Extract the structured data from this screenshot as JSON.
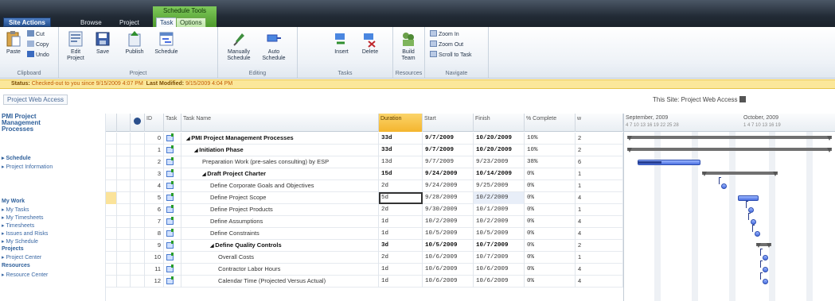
{
  "nav": {
    "site_actions": "Site Actions",
    "browse": "Browse",
    "project": "Project",
    "context_group": "Schedule Tools",
    "tab_task": "Task",
    "tab_options": "Options"
  },
  "ribbon": {
    "clipboard": {
      "label": "Clipboard",
      "paste": "Paste",
      "cut": "Cut",
      "copy": "Copy",
      "undo": "Undo"
    },
    "project": {
      "label": "Project",
      "edit": "Edit Project",
      "save": "Save",
      "publish": "Publish",
      "schedule": "Schedule"
    },
    "editing": {
      "label": "Editing",
      "manually": "Manually Schedule",
      "auto": "Auto Schedule"
    },
    "tasks": {
      "label": "Tasks",
      "insert": "Insert",
      "delete": "Delete"
    },
    "resources": {
      "label": "Resources",
      "build_team": "Build Team"
    },
    "navigate": {
      "label": "Navigate",
      "zoom_in": "Zoom In",
      "zoom_out": "Zoom Out",
      "scroll": "Scroll to Task"
    }
  },
  "status": {
    "label": "Status:",
    "text": "Checked-out to you since 9/15/2009 4:07 PM",
    "modified_label": "Last Modified:",
    "modified": "9/15/2009 4:04 PM"
  },
  "strip": {
    "breadcrumb": "Project Web Access",
    "site_title": "This Site: Project Web Access"
  },
  "leftnav": {
    "title": "PMI Project Management Processes",
    "schedule": "Schedule",
    "project_information": "Project Information",
    "my_work": "My Work",
    "my_work_items": [
      "My Tasks",
      "My Timesheets",
      "Timesheets",
      "Issues and Risks",
      "My Schedule"
    ],
    "projects": "Projects",
    "project_center": "Project Center",
    "resources": "Resources",
    "resource_center": "Resource Center"
  },
  "grid": {
    "columns": {
      "id": "ID",
      "mode": "Task",
      "name": "Task Name",
      "duration": "Duration",
      "start": "Start",
      "finish": "Finish",
      "pct": "% Complete",
      "extra": "w"
    },
    "rows": [
      {
        "id": "0",
        "name": "PMI Project Management Processes",
        "indent": 0,
        "summary": true,
        "duration": "33d",
        "start": "9/7/2009",
        "finish": "10/20/2009",
        "pct": "10%",
        "extra": "2"
      },
      {
        "id": "1",
        "name": "Initiation Phase",
        "indent": 1,
        "summary": true,
        "duration": "33d",
        "start": "9/7/2009",
        "finish": "10/20/2009",
        "pct": "10%",
        "extra": "2"
      },
      {
        "id": "2",
        "name": "Preparation Work (pre-sales consulting) by ESP",
        "indent": 2,
        "summary": false,
        "duration": "13d",
        "start": "9/7/2009",
        "finish": "9/23/2009",
        "pct": "38%",
        "extra": "6"
      },
      {
        "id": "3",
        "name": "Draft Project Charter",
        "indent": 2,
        "summary": true,
        "duration": "15d",
        "start": "9/24/2009",
        "finish": "10/14/2009",
        "pct": "0%",
        "extra": "1"
      },
      {
        "id": "4",
        "name": "Define Corporate Goals and Objectives",
        "indent": 3,
        "summary": false,
        "duration": "2d",
        "start": "9/24/2009",
        "finish": "9/25/2009",
        "pct": "0%",
        "extra": "1"
      },
      {
        "id": "5",
        "name": "Define Project Scope",
        "indent": 3,
        "summary": false,
        "duration": "5d",
        "start": "9/28/2009",
        "finish": "10/2/2009",
        "pct": "0%",
        "extra": "4"
      },
      {
        "id": "6",
        "name": "Define Project Products",
        "indent": 3,
        "summary": false,
        "duration": "2d",
        "start": "9/30/2009",
        "finish": "10/1/2009",
        "pct": "0%",
        "extra": "1"
      },
      {
        "id": "7",
        "name": "Define Assumptions",
        "indent": 3,
        "summary": false,
        "duration": "1d",
        "start": "10/2/2009",
        "finish": "10/2/2009",
        "pct": "0%",
        "extra": "4"
      },
      {
        "id": "8",
        "name": "Define Constraints",
        "indent": 3,
        "summary": false,
        "duration": "1d",
        "start": "10/5/2009",
        "finish": "10/5/2009",
        "pct": "0%",
        "extra": "4"
      },
      {
        "id": "9",
        "name": "Define Quality Controls",
        "indent": 3,
        "summary": true,
        "duration": "3d",
        "start": "10/5/2009",
        "finish": "10/7/2009",
        "pct": "0%",
        "extra": "2"
      },
      {
        "id": "10",
        "name": "Overall Costs",
        "indent": 4,
        "summary": false,
        "duration": "2d",
        "start": "10/6/2009",
        "finish": "10/7/2009",
        "pct": "0%",
        "extra": "1"
      },
      {
        "id": "11",
        "name": "Contractor Labor Hours",
        "indent": 4,
        "summary": false,
        "duration": "1d",
        "start": "10/6/2009",
        "finish": "10/6/2009",
        "pct": "0%",
        "extra": "4"
      },
      {
        "id": "12",
        "name": "Calendar Time (Projected Versus Actual)",
        "indent": 4,
        "summary": false,
        "duration": "1d",
        "start": "10/6/2009",
        "finish": "10/6/2009",
        "pct": "0%",
        "extra": "4"
      }
    ]
  },
  "gantt": {
    "month_left": "September, 2009",
    "month_right": "October, 2009",
    "days_left": "4  7  10 13 16 19 22 25 28",
    "days_right": "1  4  7  10 13 16 19",
    "bars": [
      {
        "type": "summary",
        "start": 0.0,
        "end": 0.98
      },
      {
        "type": "summary",
        "start": 0.0,
        "end": 0.98
      },
      {
        "type": "task",
        "start": 0.05,
        "end": 0.35,
        "progress": 0.38
      },
      {
        "type": "summary",
        "start": 0.36,
        "end": 0.72
      },
      {
        "type": "milestone",
        "start": 0.45
      },
      {
        "type": "task",
        "start": 0.53,
        "end": 0.63
      },
      {
        "type": "milestone",
        "start": 0.58
      },
      {
        "type": "milestone",
        "start": 0.59
      },
      {
        "type": "milestone",
        "start": 0.61
      },
      {
        "type": "summary",
        "start": 0.62,
        "end": 0.69
      },
      {
        "type": "milestone",
        "start": 0.65
      },
      {
        "type": "milestone",
        "start": 0.65
      },
      {
        "type": "milestone",
        "start": 0.65
      }
    ]
  },
  "colors": {
    "duration_header": "#f4b52e",
    "status_bar": "#fbe79a",
    "task_bar": "#4a6fe0",
    "summary_bar": "#707070",
    "selected_row": "#fbe39a"
  }
}
